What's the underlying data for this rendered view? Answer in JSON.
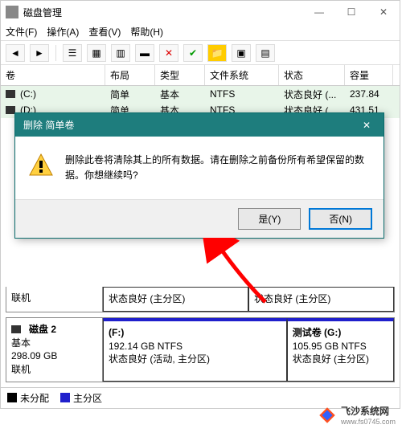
{
  "window": {
    "title": "磁盘管理",
    "menus": [
      "文件(F)",
      "操作(A)",
      "查看(V)",
      "帮助(H)"
    ],
    "sysbtns": {
      "min": "—",
      "max": "☐",
      "close": "✕"
    }
  },
  "table": {
    "headers": [
      "卷",
      "布局",
      "类型",
      "文件系统",
      "状态",
      "容量"
    ],
    "rows": [
      {
        "vol": "(C:)",
        "layout": "简单",
        "type": "基本",
        "fs": "NTFS",
        "status": "状态良好 (...",
        "cap": "237.84"
      },
      {
        "vol": "(D:)",
        "layout": "简单",
        "type": "基本",
        "fs": "NTFS",
        "status": "状态良好 (...",
        "cap": "431.51"
      }
    ]
  },
  "dialog": {
    "title": "删除 简单卷",
    "close": "✕",
    "message": "删除此卷将清除其上的所有数据。请在删除之前备份所有希望保留的数据。你想继续吗?",
    "yes": "是(Y)",
    "no": "否(N)"
  },
  "disk1": {
    "online": "联机",
    "part1": "状态良好 (主分区)",
    "part2": "状态良好 (主分区)"
  },
  "disk2": {
    "name": "磁盘 2",
    "type": "基本",
    "size": "298.09 GB",
    "online": "联机",
    "parts": [
      {
        "label": "(F:)",
        "size": "192.14 GB NTFS",
        "status": "状态良好 (活动, 主分区)"
      },
      {
        "label": "测试卷  (G:)",
        "size": "105.95 GB NTFS",
        "status": "状态良好 (主分区)"
      }
    ]
  },
  "legend": {
    "unalloc": "未分配",
    "primary": "主分区"
  },
  "watermark": "飞沙系统网",
  "watermark_url": "www.fs0745.com"
}
